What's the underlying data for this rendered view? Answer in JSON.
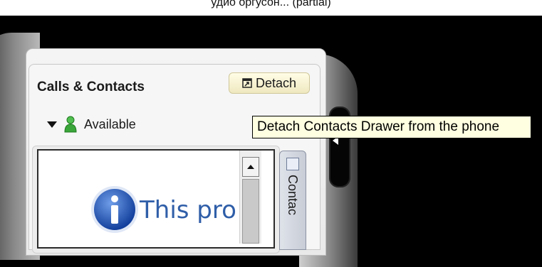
{
  "header": {
    "title": "Calls & Contacts",
    "detach_label": "Detach"
  },
  "status": {
    "value": "Available"
  },
  "contacts": {
    "message": "This pro"
  },
  "side_tab": {
    "label": "Contac"
  },
  "tooltip": {
    "text": "Detach Contacts Drawer from the phone"
  },
  "top_strip": {
    "text": "удио оргусон... (partial)"
  },
  "colors": {
    "background": "#000000",
    "panel": "#f4f4f4",
    "detach_button": "#fffde6",
    "tooltip": "#ffffe1",
    "info_blue": "#2f5ea8",
    "status_green": "#3aa63a"
  },
  "icons": {
    "detach": "detach-icon",
    "status": "person-available-icon",
    "dropdown": "triangle-down-icon",
    "info": "info-icon",
    "scroll_up": "arrow-up-icon",
    "side_tab": "contacts-tab-icon",
    "handle": "arrow-left-icon"
  }
}
